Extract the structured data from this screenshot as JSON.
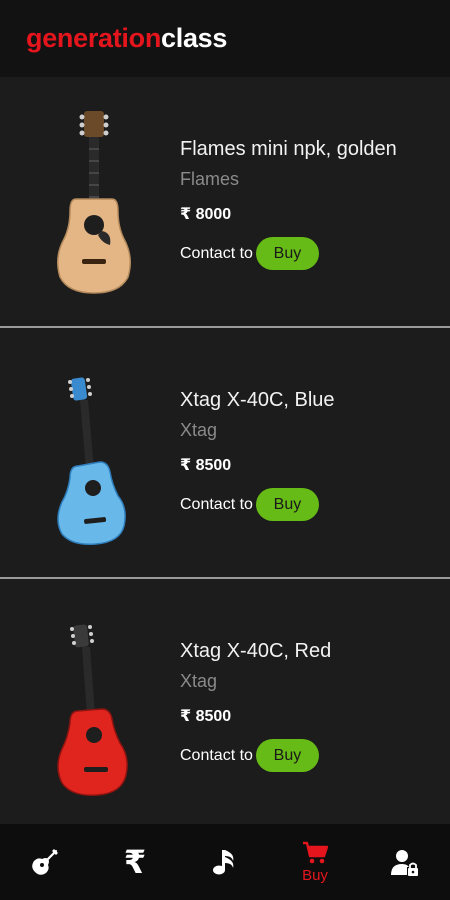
{
  "header": {
    "logo_part1": "generation",
    "logo_part2": "class"
  },
  "products": [
    {
      "name": "Flames mini npk, golden",
      "brand": "Flames",
      "price": "₹ 8000",
      "contact_label": "Contact to",
      "buy_label": "Buy",
      "guitar_color": "#e4b686",
      "guitar_icon": "guitar-natural-image"
    },
    {
      "name": "Xtag X-40C, Blue",
      "brand": "Xtag",
      "price": "₹ 8500",
      "contact_label": "Contact to",
      "buy_label": "Buy",
      "guitar_color": "#68b8ea",
      "guitar_icon": "guitar-blue-image"
    },
    {
      "name": "Xtag X-40C, Red",
      "brand": "Xtag",
      "price": "₹ 8500",
      "contact_label": "Contact to",
      "buy_label": "Buy",
      "guitar_color": "#e0241e",
      "guitar_icon": "guitar-red-image"
    }
  ],
  "bottom_nav": {
    "items": [
      {
        "icon": "guitar-icon",
        "active": false
      },
      {
        "icon": "rupee-icon",
        "glyph": "₹",
        "active": false
      },
      {
        "icon": "music-note-icon",
        "active": false
      },
      {
        "icon": "cart-icon",
        "label": "Buy",
        "active": true
      },
      {
        "icon": "user-lock-icon",
        "active": false
      }
    ]
  },
  "colors": {
    "brand_red": "#e5151d",
    "buy_green": "#66bb16",
    "background": "#1c1c1c",
    "header_bg": "#121212",
    "nav_bg": "#0d0d0d"
  }
}
